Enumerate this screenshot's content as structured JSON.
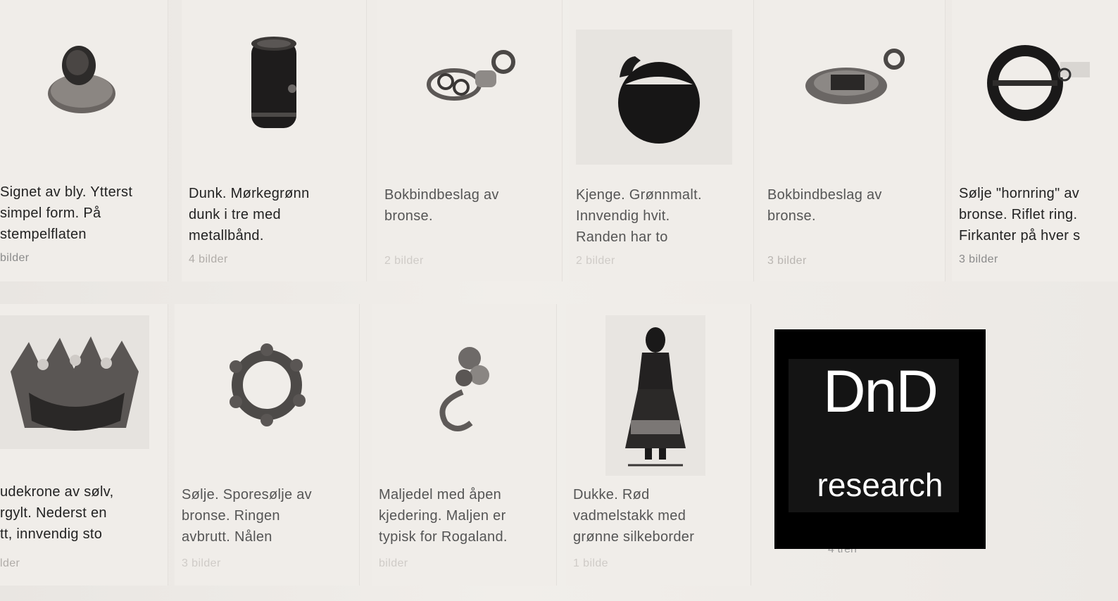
{
  "row1": [
    {
      "name": "item-signet",
      "caption": "Signet av bly. Ytterst\nsimpel form. På\nstempelflaten",
      "count": "bilder",
      "icon": "lead-seal-icon"
    },
    {
      "name": "item-dunk",
      "caption": "Dunk. Mørkegrønn\ndunk i tre med\nmetallbånd.",
      "count": "4 bilder",
      "icon": "wooden-keg-icon"
    },
    {
      "name": "item-bokbindbeslag-1",
      "caption": "Bokbindbeslag av\nbronse.",
      "count": "2 bilder",
      "icon": "bronze-clasp-icon"
    },
    {
      "name": "item-kjenge",
      "caption": "Kjenge. Grønnmalt.\nInnvendig hvit.\nRanden har to",
      "count": "2 bilder",
      "icon": "wooden-bowl-icon"
    },
    {
      "name": "item-bokbindbeslag-2",
      "caption": "Bokbindbeslag av\nbronse.",
      "count": "3 bilder",
      "icon": "bronze-clasp-icon"
    },
    {
      "name": "item-solje-hornring",
      "caption": "Sølje \"hornring\" av\nbronse. Riflet ring.\nFirkanter på hver s",
      "count": "3 bilder",
      "icon": "ring-brooch-icon"
    }
  ],
  "row2": [
    {
      "name": "item-brudekrone",
      "caption": "udekrone av sølv,\nrgylt. Nederst en\ntt, innvendig sto",
      "count": "lder",
      "icon": "bridal-crown-icon"
    },
    {
      "name": "item-solje-sporesolje",
      "caption": "Sølje. Sporesølje av\nbronse. Ringen\navbrutt. Nålen",
      "count": "3 bilder",
      "icon": "spur-brooch-icon"
    },
    {
      "name": "item-maljedel",
      "caption": "Maljedel med åpen\nkjedering. Maljen er\ntypisk for Rogaland.",
      "count": "bilder",
      "icon": "eyelet-hook-icon"
    },
    {
      "name": "item-dukke",
      "caption": "Dukke. Rød\nvadmelstakk med\ngrønne silkeborder",
      "count": "1 bilde",
      "icon": "doll-icon"
    }
  ],
  "logo": {
    "title": "DnD",
    "subtitle": "research"
  },
  "under_logo_text": "4 tren"
}
